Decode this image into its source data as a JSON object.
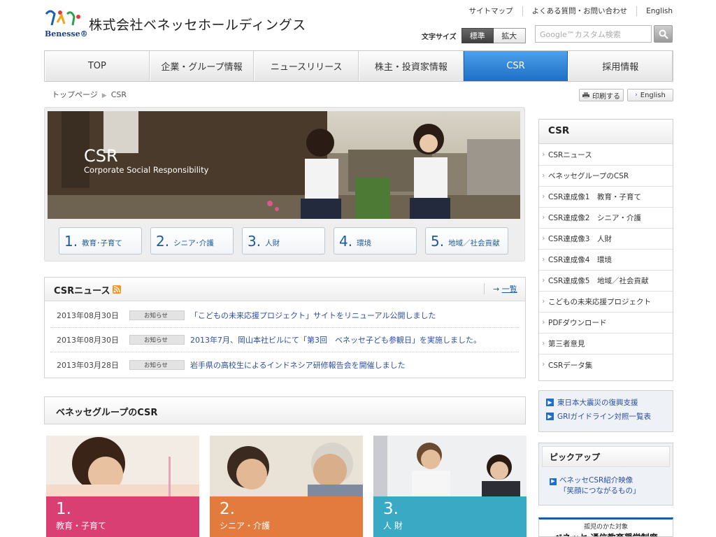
{
  "header": {
    "brand": "Benesse®",
    "company": "株式会社ベネッセホールディングス",
    "util_links": [
      "サイトマップ",
      "よくある質問・お問い合わせ",
      "English"
    ],
    "font_size_label": "文字サイズ",
    "font_size_options": [
      "標準",
      "拡大"
    ],
    "search_placeholder": "Google™カスタム検索"
  },
  "nav": {
    "items": [
      "TOP",
      "企業・グループ情報",
      "ニュースリリース",
      "株主・投資家情報",
      "CSR",
      "採用情報"
    ],
    "active": "CSR"
  },
  "breadcrumb": [
    "トップページ",
    "CSR"
  ],
  "actions": {
    "print": "印刷する",
    "english": "English"
  },
  "hero": {
    "title": "CSR",
    "subtitle": "Corporate Social Responsibility",
    "pillars": [
      {
        "num": "1.",
        "label": "教育･子育て"
      },
      {
        "num": "2.",
        "label": "シニア･介護"
      },
      {
        "num": "3.",
        "label": "人財"
      },
      {
        "num": "4.",
        "label": "環境"
      },
      {
        "num": "5.",
        "label": "地域／社会貢献"
      }
    ]
  },
  "news": {
    "title": "CSRニュース",
    "more": "一覧",
    "items": [
      {
        "date": "2013年08月30日",
        "tag": "お知らせ",
        "text": "「こどもの未来応援プロジェクト」サイトをリニューアル公開しました"
      },
      {
        "date": "2013年08月30日",
        "tag": "お知らせ",
        "text": "2013年7月、岡山本社ビルにて「第3回　ベネッセ子ども参観日」を実施しました。"
      },
      {
        "date": "2013年03月28日",
        "tag": "お知らせ",
        "text": "岩手県の高校生によるインドネシア研修報告会を開催しました"
      }
    ]
  },
  "group": {
    "title": "ベネッセグループのCSR",
    "cards": [
      {
        "num": "1.",
        "label": "教育・子育て",
        "color": "#d93f73"
      },
      {
        "num": "2.",
        "label": "シニア・介護",
        "color": "#e37b3e"
      },
      {
        "num": "3.",
        "label": "人 財",
        "color": "#3aa9c4"
      }
    ]
  },
  "sidebar": {
    "title": "CSR",
    "items": [
      "CSRニュース",
      "ベネッセグループのCSR",
      "CSR達成像1　教育・子育て",
      "CSR達成像2　シニア・介護",
      "CSR達成像3　人財",
      "CSR達成像4　環境",
      "CSR達成像5　地域／社会貢献",
      "こどもの未来応援プロジェクト",
      "PDFダウンロード",
      "第三者意見",
      "CSRデータ集"
    ],
    "links": [
      "東日本大震災の復興支援",
      "GRIガイドライン対照一覧表"
    ],
    "pickup_title": "ピックアップ",
    "pickup_link_1": "ベネッセCSR紹介映像",
    "pickup_link_2": "「笑顔につながるもの」",
    "banner_top": "孤児のかた対象",
    "banner_bottom": "ベネッセ 通信教育奨学制度"
  },
  "colors": {
    "accent": "#1f6fc6",
    "link": "#2b4fa8",
    "nav_active": "#3a8de0"
  }
}
